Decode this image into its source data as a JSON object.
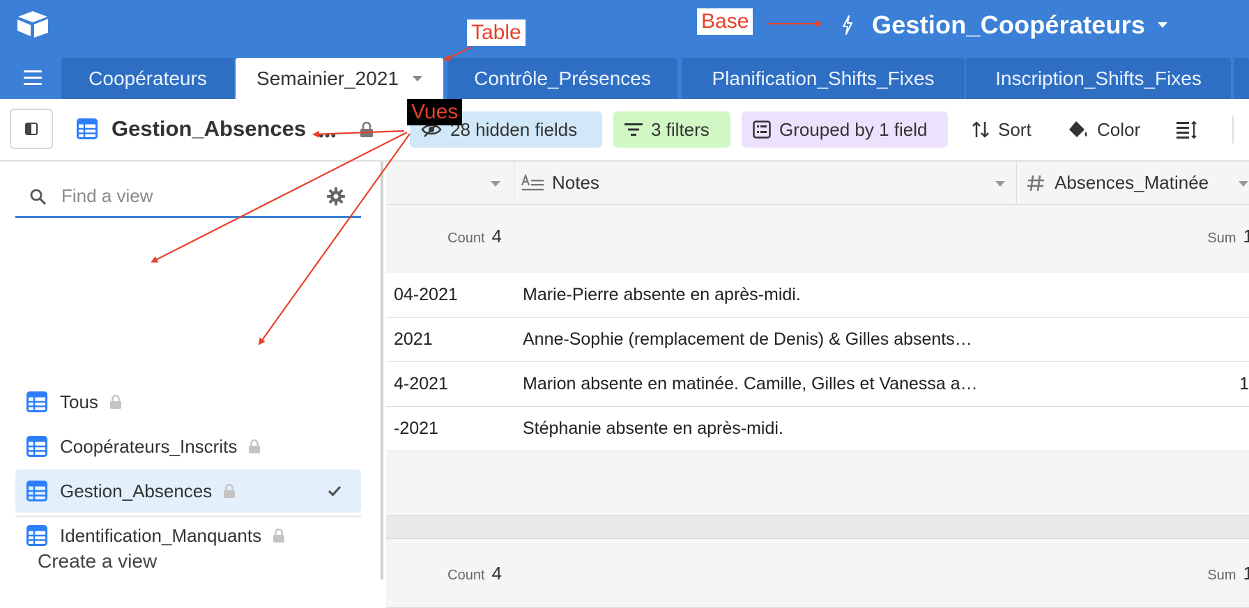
{
  "header": {
    "base_name": "Gestion_Coopérateurs"
  },
  "tabs": [
    {
      "label": "Coopérateurs",
      "active": false
    },
    {
      "label": "Semainier_2021",
      "active": true
    },
    {
      "label": "Contrôle_Présences",
      "active": false
    },
    {
      "label": "Planification_Shifts_Fixes",
      "active": false
    },
    {
      "label": "Inscription_Shifts_Fixes",
      "active": false
    }
  ],
  "toolbar": {
    "current_view": "Gestion_Absences",
    "hidden_fields": "28 hidden fields",
    "filters": "3 filters",
    "grouped": "Grouped by 1 field",
    "sort": "Sort",
    "color": "Color"
  },
  "view_panel": {
    "search_placeholder": "Find a view",
    "views": [
      {
        "label": "Tous",
        "selected": false
      },
      {
        "label": "Coopérateurs_Inscrits",
        "selected": false
      },
      {
        "label": "Gestion_Absences",
        "selected": true
      },
      {
        "label": "Identification_Manquants",
        "selected": false
      }
    ],
    "create_label": "Create a view"
  },
  "grid": {
    "columns": [
      {
        "label": "Notes",
        "icon": "long-text-icon"
      },
      {
        "label": "Absences_Matinée",
        "icon": "number-icon"
      }
    ],
    "groups": [
      {
        "count_label": "Count",
        "count_value": "4",
        "sum_label": "Sum",
        "sum_value": "1",
        "rows": [
          {
            "date": "04-2021",
            "notes": "Marie-Pierre absente en après-midi.",
            "absences": ""
          },
          {
            "date": "2021",
            "notes": "Anne-Sophie (remplacement de Denis) & Gilles absents…",
            "absences": ""
          },
          {
            "date": "4-2021",
            "notes": "Marion absente en matinée. Camille, Gilles et Vanessa a…",
            "absences": "1"
          },
          {
            "date": "-2021",
            "notes": "Stéphanie absente en après-midi.",
            "absences": ""
          }
        ]
      },
      {
        "count_label": "Count",
        "count_value": "4",
        "sum_label": "Sum",
        "sum_value": "1",
        "rows": []
      }
    ]
  },
  "annotations": {
    "base": "Base",
    "table": "Table",
    "views": "Vues"
  },
  "colors": {
    "topbar": "#3b80d6",
    "accent": "#3b80d6",
    "annotation": "#e8402a"
  }
}
